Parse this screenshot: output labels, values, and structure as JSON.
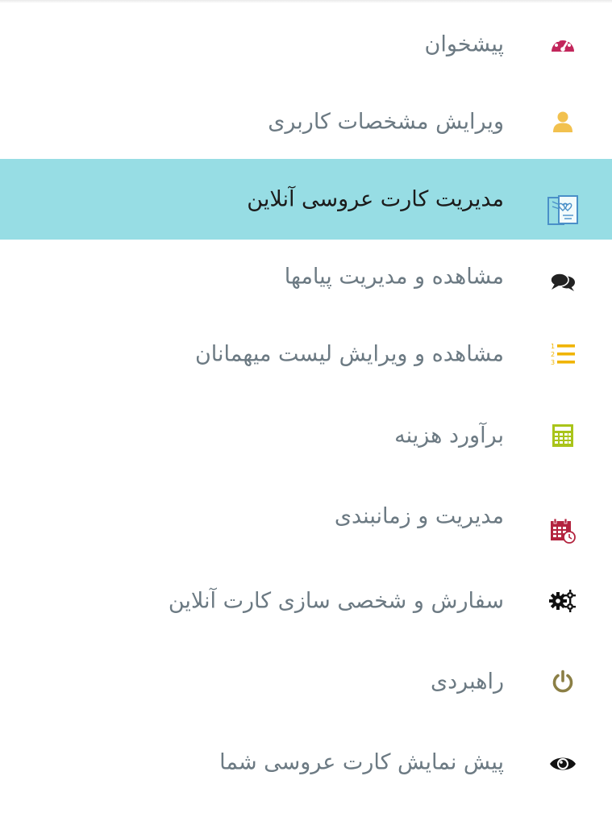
{
  "menu": {
    "items": [
      {
        "label": "پیشخوان",
        "icon": "dashboard-icon",
        "icon_color": "#c2265b",
        "active": false
      },
      {
        "label": "ویرایش مشخصات کاربری",
        "icon": "user-icon",
        "icon_color": "#f2c14e",
        "active": false
      },
      {
        "label": "مدیریت کارت عروسی آنلاین",
        "icon": "wedding-card-icon",
        "icon_color": "#4a90c8",
        "active": true
      },
      {
        "label": "مشاهده و مدیریت پیامها",
        "icon": "chat-bubbles-icon",
        "icon_color": "#222222",
        "active": false
      },
      {
        "label": "مشاهده و ویرایش لیست میهمانان",
        "icon": "numbered-list-icon",
        "icon_color": "#f0b400",
        "active": false
      },
      {
        "label": "برآورد هزینه",
        "icon": "calculator-icon",
        "icon_color": "#a9c41a",
        "active": false
      },
      {
        "label": "مدیریت و زمانبندی",
        "icon": "calendar-clock-icon",
        "icon_color": "#b3243f",
        "active": false
      },
      {
        "label": "سفارش و شخصی سازی کارت آنلاین",
        "icon": "gears-icon",
        "icon_color": "#111111",
        "active": false
      },
      {
        "label": "راهبردی",
        "icon": "power-icon",
        "icon_color": "#8b7f45",
        "active": false
      },
      {
        "label": "پیش نمایش کارت عروسی شما",
        "icon": "eye-icon",
        "icon_color": "#111111",
        "active": false
      }
    ]
  },
  "colors": {
    "active_background": "#97dde4",
    "label_text": "#6c7a83",
    "active_label_text": "#1b1b1b"
  }
}
